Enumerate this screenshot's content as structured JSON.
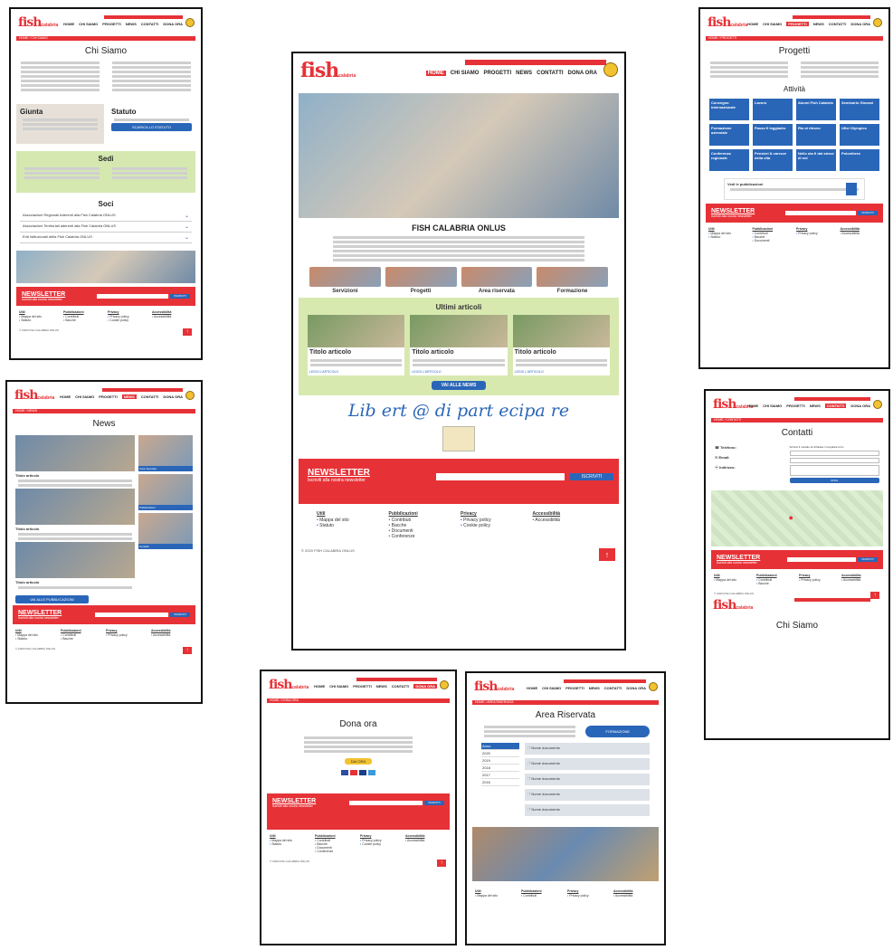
{
  "logo": {
    "brand": "fish",
    "sub": "calabria"
  },
  "nav": {
    "items": [
      "HOME",
      "CHI SIAMO",
      "PROGETTI",
      "NEWS",
      "CONTATTI",
      "DONA ORA"
    ]
  },
  "chi_siamo": {
    "crumb": "HOME / CHI SIAMO",
    "title": "Chi Siamo",
    "giunta": "Giunta",
    "statuto": "Statuto",
    "statuto_btn": "SCARICA LO STATUTO",
    "sedi": "Sedi",
    "soci": "Soci",
    "soci_items": [
      "Associazioni Regionali Aderenti alla Fish Calabria ONLUS",
      "Associazioni Territoriali aderenti alla Fish Calabria ONLUS",
      "Enti Istituzionali della Fish Calabria ONLUS"
    ],
    "repeat_title": "Chi Siamo"
  },
  "progetti": {
    "crumb": "HOME / PROGETTI",
    "title": "Progetti",
    "attivita": "Attività",
    "tiles": [
      "Convegno internazionale",
      "Lavoro",
      "Alunni Fish Calabria",
      "Seminario Giovani",
      "Formazione aziendale",
      "Passo fi leggiadro",
      "Rio al ritrovo",
      "Ufici Olympics",
      "Conferenza regionale",
      "Pensieri & carezze della vita",
      "Nello sta fi dai stessi di noi",
      "Polonibera"
    ],
    "pubblicazioni": "Vedi le pubblicazioni"
  },
  "home": {
    "org_title": "FISH CALABRIA ONLUS",
    "categories": [
      "Servizioni",
      "Progetti",
      "Area riservata",
      "Formazione"
    ],
    "articles_title": "Ultimi articoli",
    "article_title": "Titolo articolo",
    "article_link": "LEGGI L'ARTICOLO",
    "all_news": "VAI ALLE NEWS",
    "banner": "Lib ert @ di part ecipa re"
  },
  "news": {
    "crumb": "HOME / NEWS",
    "title": "News",
    "article_title": "Titolo articolo",
    "side_labels": [
      "Area riservata",
      "Pubblicazioni",
      "Contatti"
    ],
    "more_btn": "VAI ALLE PUBBLICAZIONI"
  },
  "contatti": {
    "crumb": "HOME / CONTATTI",
    "title": "Contatti",
    "telefono_label": "Telefono:",
    "email_label": "Email:",
    "indirizzo_label": "Indirizzo:",
    "form_intro": "Scrivici il modulo di richiesta / compilare form",
    "send": "INVIA"
  },
  "dona": {
    "crumb": "HOME / DONA ORA",
    "title": "Dona ora",
    "btn": "DAI ORA"
  },
  "area": {
    "crumb": "HOME / AREA RISERVATA",
    "title": "Area Riservata",
    "form_btn": "FORMAZIONE",
    "years": [
      "Anno",
      "2020",
      "2019",
      "2018",
      "2017",
      "2016"
    ],
    "doc": "Nome documento"
  },
  "newsletter": {
    "title": "NEWSLETTER",
    "sub": "Iscriviti alla nostra newsletter",
    "btn": "ISCRIVITI"
  },
  "footer": {
    "col1": {
      "title": "Utili",
      "items": [
        "Mappa del sito",
        "Statuto"
      ]
    },
    "col2": {
      "title": "Pubblicazioni",
      "items": [
        "Contributi",
        "Bacche",
        "Documenti",
        "Conferenze"
      ]
    },
    "col3": {
      "title": "Privacy",
      "items": [
        "Privacy policy",
        "Cookie policy"
      ]
    },
    "col4": {
      "title": "Accessibilità",
      "items": [
        "Accessibilità"
      ]
    },
    "copyright": "© 2020 FISH CALABRIA ONLUS"
  },
  "colors": {
    "brand_red": "#e63237",
    "blue": "#2a66b8",
    "green": "#d5e8b0"
  }
}
